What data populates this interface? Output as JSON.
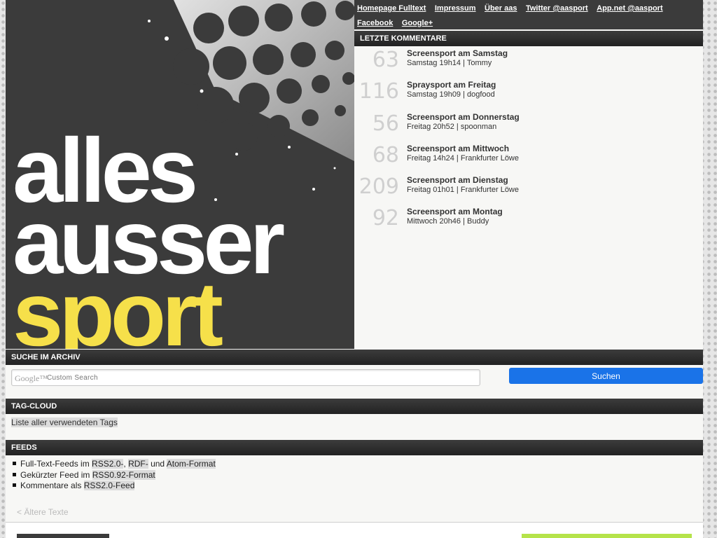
{
  "logo": {
    "line1": "alles",
    "line2": "ausser",
    "line3": "sport",
    "colors": {
      "background": "#3b3b3b",
      "text": "#ffffff",
      "accent": "#f6e04a"
    }
  },
  "topnav": {
    "links": [
      "Homepage Fulltext",
      "Impressum",
      "Über aas",
      "Twitter @aasport",
      "App.net @aasport",
      "Facebook",
      "Google+"
    ]
  },
  "comments": {
    "header": "LETZTE KOMMENTARE",
    "items": [
      {
        "count": "63",
        "title": "Screensport am Samstag",
        "meta": "Samstag 19h14 | Tommy"
      },
      {
        "count": "116",
        "title": "Spraysport am Freitag",
        "meta": "Samstag 19h09 | dogfood"
      },
      {
        "count": "56",
        "title": "Screensport am Donnerstag",
        "meta": "Freitag 20h52 | spoonman"
      },
      {
        "count": "68",
        "title": "Screensport am Mittwoch",
        "meta": "Freitag 14h24 | Frankfurter Löwe"
      },
      {
        "count": "209",
        "title": "Screensport am Dienstag",
        "meta": "Freitag 01h01 | Frankfurter Löwe"
      },
      {
        "count": "92",
        "title": "Screensport am Montag",
        "meta": "Mittwoch 20h46 | Buddy"
      }
    ]
  },
  "search": {
    "header": "SUCHE IM ARCHIV",
    "google_mark": "Google™",
    "placeholder": "Custom Search",
    "button": "Suchen"
  },
  "tags": {
    "header": "TAG-CLOUD",
    "link": "Liste aller verwendeten Tags"
  },
  "feeds": {
    "header": "FEEDS",
    "line1": {
      "pre": "Full-Text-Feeds im ",
      "rss": "RSS2.0-",
      "sep": ", ",
      "rdf": "RDF-",
      "und": " und ",
      "atom": "Atom-Format"
    },
    "line2": {
      "pre": "Gekürzter Feed im ",
      "rss": "RSS0.92-Format"
    },
    "line3": {
      "pre": "Kommentare als ",
      "rss": "RSS2.0-Feed"
    }
  },
  "pagination": {
    "older": "< Ältere Texte"
  }
}
